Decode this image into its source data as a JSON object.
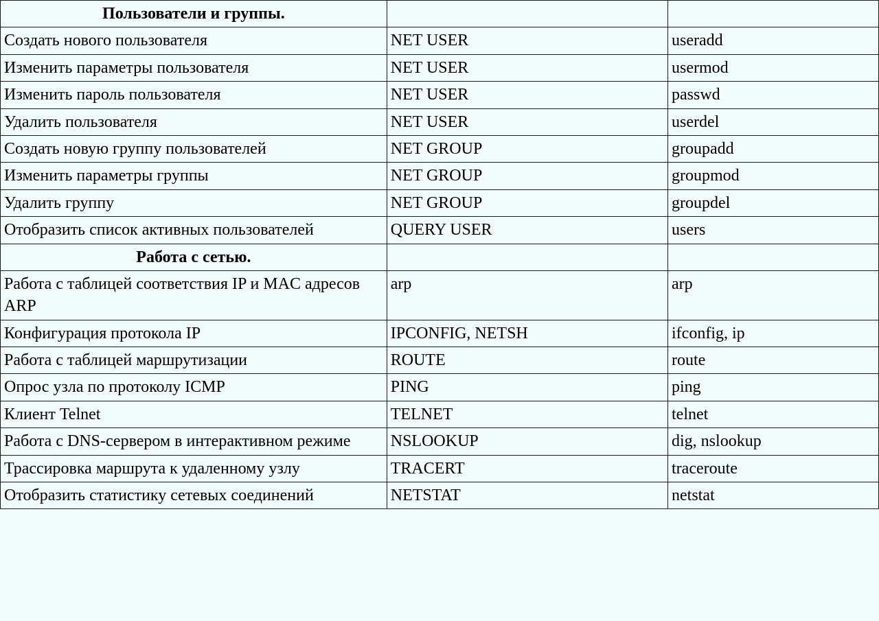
{
  "table": {
    "rows": [
      {
        "type": "header",
        "desc": "Пользователи и группы.",
        "win": "",
        "linux": ""
      },
      {
        "type": "data",
        "desc": "Создать нового пользователя",
        "win": "NET USER",
        "linux": "useradd"
      },
      {
        "type": "data",
        "desc": "Изменить параметры пользователя",
        "win": "NET USER",
        "linux": "usermod"
      },
      {
        "type": "data",
        "desc": "Изменить пароль пользователя",
        "win": "NET USER",
        "linux": "passwd"
      },
      {
        "type": "data",
        "desc": "Удалить пользователя",
        "win": "NET USER",
        "linux": "userdel"
      },
      {
        "type": "data",
        "desc": "Создать новую группу пользователей",
        "win": "NET GROUP",
        "linux": "groupadd"
      },
      {
        "type": "data",
        "desc": "Изменить параметры группы",
        "win": "NET GROUP",
        "linux": "groupmod"
      },
      {
        "type": "data",
        "desc": "Удалить группу",
        "win": "NET GROUP",
        "linux": "groupdel"
      },
      {
        "type": "data",
        "desc": "Отобразить список активных пользователей",
        "win": "QUERY USER",
        "linux": "users"
      },
      {
        "type": "header",
        "desc": "Работа с сетью.",
        "win": "",
        "linux": ""
      },
      {
        "type": "data",
        "desc": "Работа с таблицей соответствия IP и MAC адресов ARP",
        "win": "arp",
        "linux": "arp"
      },
      {
        "type": "data",
        "desc": "Конфигурация протокола IP",
        "win": "IPCONFIG, NETSH",
        "linux": "ifconfig, ip"
      },
      {
        "type": "data",
        "desc": "Работа с таблицей маршрутизации",
        "win": "ROUTE",
        "linux": "route"
      },
      {
        "type": "data",
        "desc": "Опрос узла по протоколу ICMP",
        "win": "PING",
        "linux": "ping"
      },
      {
        "type": "data",
        "desc": "Клиент Telnet",
        "win": "TELNET",
        "linux": "telnet"
      },
      {
        "type": "data",
        "desc": "Работа с DNS-сервером в интерактивном режиме",
        "win": "NSLOOKUP",
        "linux": "dig, nslookup"
      },
      {
        "type": "data",
        "desc": "Трассировка маршрута к удаленному узлу",
        "win": "TRACERT",
        "linux": "traceroute"
      },
      {
        "type": "data",
        "desc": "Отобразить статистику сетевых соединений",
        "win": "NETSTAT",
        "linux": "netstat"
      }
    ]
  }
}
